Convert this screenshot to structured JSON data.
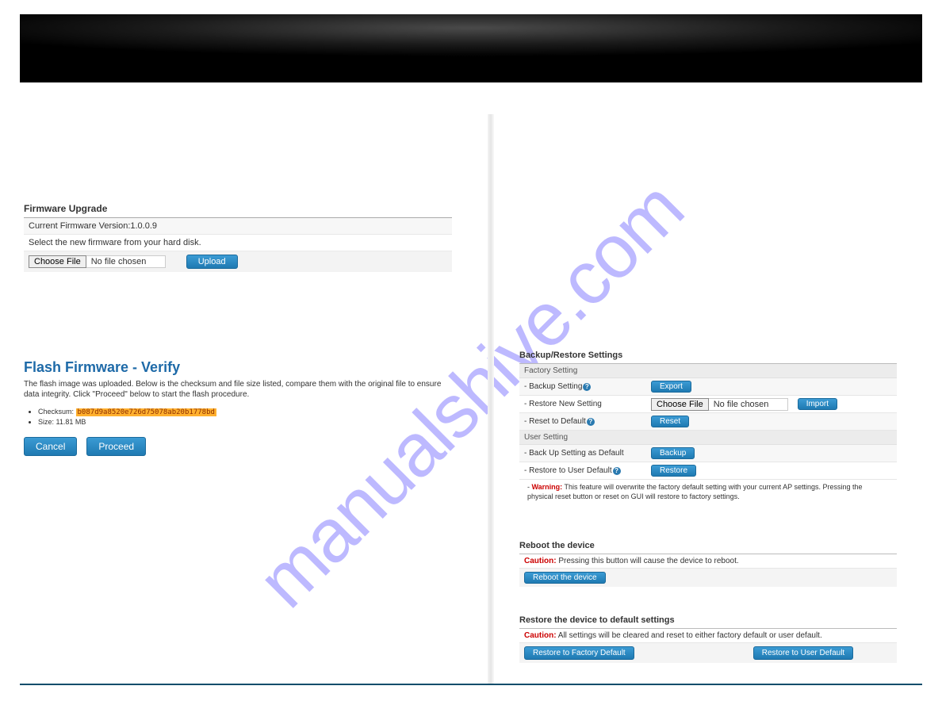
{
  "watermark": "manualshive.com",
  "firmware_upgrade": {
    "heading": "Firmware Upgrade",
    "version_line": "Current Firmware Version:1.0.0.9",
    "select_prompt": "Select the new firmware from your hard disk.",
    "choose_file_label": "Choose File",
    "no_file_text": "No file chosen",
    "upload_label": "Upload"
  },
  "flash_verify": {
    "title": "Flash Firmware - Verify",
    "description": "The flash image was uploaded. Below is the checksum and file size listed, compare them with the original file to ensure data integrity. Click \"Proceed\" below to start the flash procedure.",
    "checksum_label": "Checksum: ",
    "checksum_value": "b087d9a8520e726d75078ab20b1778bd",
    "size_line": "Size: 11.81 MB",
    "cancel_label": "Cancel",
    "proceed_label": "Proceed"
  },
  "backup_restore": {
    "heading": "Backup/Restore Settings",
    "factory_heading": "Factory Setting",
    "backup_setting_label": "- Backup Setting",
    "export_label": "Export",
    "restore_new_label": "- Restore New Setting",
    "choose_file_label": "Choose File",
    "no_file_text": "No file chosen",
    "import_label": "Import",
    "reset_default_label": "- Reset to Default",
    "reset_label": "Reset",
    "user_heading": "User Setting",
    "backup_as_default_label": "- Back Up Setting as Default",
    "backup_label": "Backup",
    "restore_user_default_label": "- Restore to User Default",
    "restore_label": "Restore",
    "warning_prefix": "Warning:",
    "warning_text": " This feature will overwrite the factory default setting with your current AP settings. Pressing the physical reset button or reset on GUI will restore to factory settings."
  },
  "reboot": {
    "heading": "Reboot the device",
    "caution_prefix": "Caution:",
    "caution_text": " Pressing this button will cause the device to reboot.",
    "button_label": "Reboot the device"
  },
  "restore_defaults": {
    "heading": "Restore the device to default settings",
    "caution_prefix": "Caution:",
    "caution_text": " All settings will be cleared and reset to either factory default or user default.",
    "factory_button": "Restore to Factory Default",
    "user_button": "Restore to User Default"
  }
}
